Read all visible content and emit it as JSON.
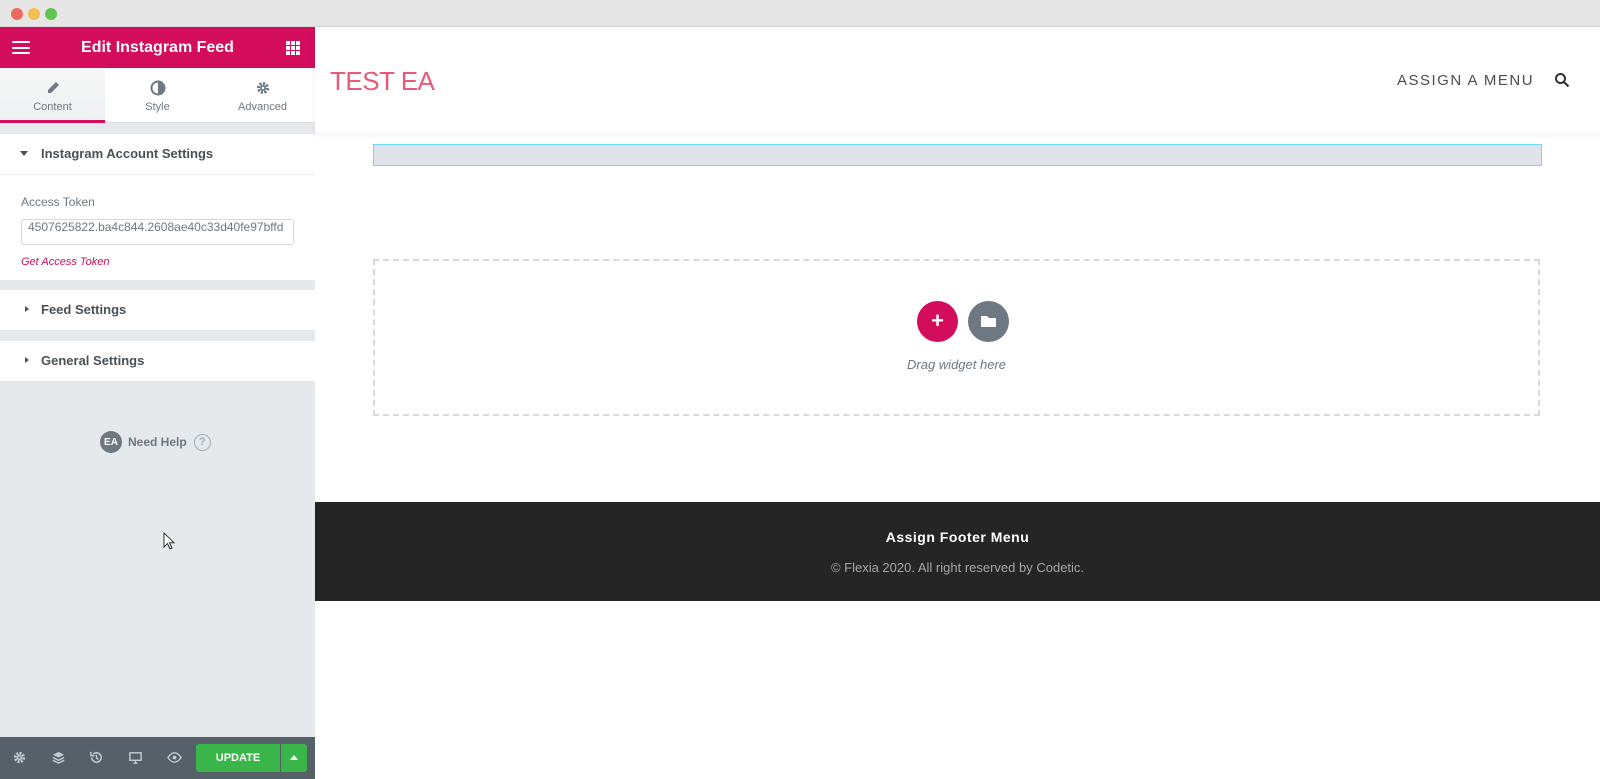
{
  "window": {
    "traffic_lights": [
      "close",
      "minimize",
      "maximize"
    ]
  },
  "panel": {
    "title": "Edit Instagram Feed",
    "tabs": [
      {
        "label": "Content",
        "icon": "pencil-icon",
        "active": true
      },
      {
        "label": "Style",
        "icon": "half-circle-icon",
        "active": false
      },
      {
        "label": "Advanced",
        "icon": "gear-icon",
        "active": false
      }
    ],
    "sections": [
      {
        "title": "Instagram Account Settings",
        "expanded": true
      },
      {
        "title": "Feed Settings",
        "expanded": false
      },
      {
        "title": "General Settings",
        "expanded": false
      }
    ],
    "access_token": {
      "label": "Access Token",
      "value": "4507625822.ba4c844.2608ae40c33d40fe97bffd",
      "link": "Get Access Token"
    },
    "help": {
      "badge": "EA",
      "label": "Need Help",
      "icon": "?"
    },
    "footer": {
      "update_label": "UPDATE",
      "icons": [
        "settings-icon",
        "layers-icon",
        "history-icon",
        "responsive-icon",
        "preview-eye-icon"
      ]
    }
  },
  "site": {
    "logo": "TEST EA",
    "menu": "ASSIGN A MENU",
    "drop_zone_text": "Drag widget here",
    "add_label": "+",
    "footer_menu": "Assign Footer Menu",
    "footer_copy": "© Flexia 2020. All right reserved by Codetic."
  },
  "colors": {
    "accent": "#d30c5c",
    "update_green": "#39b54a",
    "logo": "#e85a7a",
    "footer_bg": "#252525",
    "panel_bg": "#e6e9ec"
  }
}
